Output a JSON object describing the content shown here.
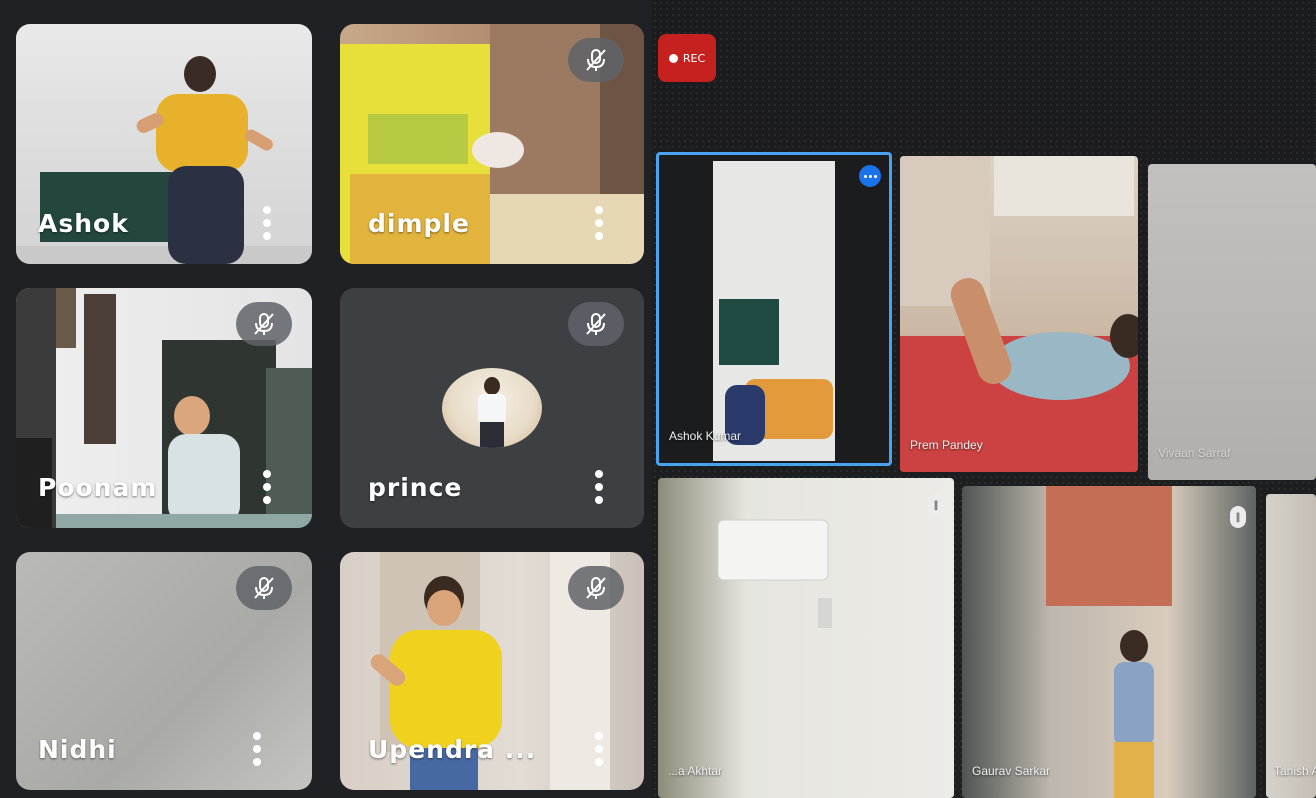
{
  "left_grid": {
    "tiles": [
      {
        "name": "Ashok"
      },
      {
        "name": "dimple"
      },
      {
        "name": "Poonam"
      },
      {
        "name": "prince"
      },
      {
        "name": "Nidhi"
      },
      {
        "name": "Upendra ..."
      }
    ]
  },
  "right_grid": {
    "rec_label": "REC",
    "tiles": [
      {
        "name": "Ashok Kumar"
      },
      {
        "name": "Prem Pandey"
      },
      {
        "name": "Vivaan Sarraf"
      },
      {
        "name": "...a Akhtar"
      },
      {
        "name": "Gaurav Sarkar"
      },
      {
        "name": "Tanish A..."
      }
    ]
  },
  "icons": {
    "mute": "mic-off-icon",
    "more": "more-vert-icon",
    "rec": "record-icon"
  },
  "colors": {
    "panel_bg": "#202124",
    "mute_bg": "#5f6368",
    "rec": "#c5221f",
    "active_border": "#4aa3f0",
    "menu_button": "#1a73e8"
  }
}
